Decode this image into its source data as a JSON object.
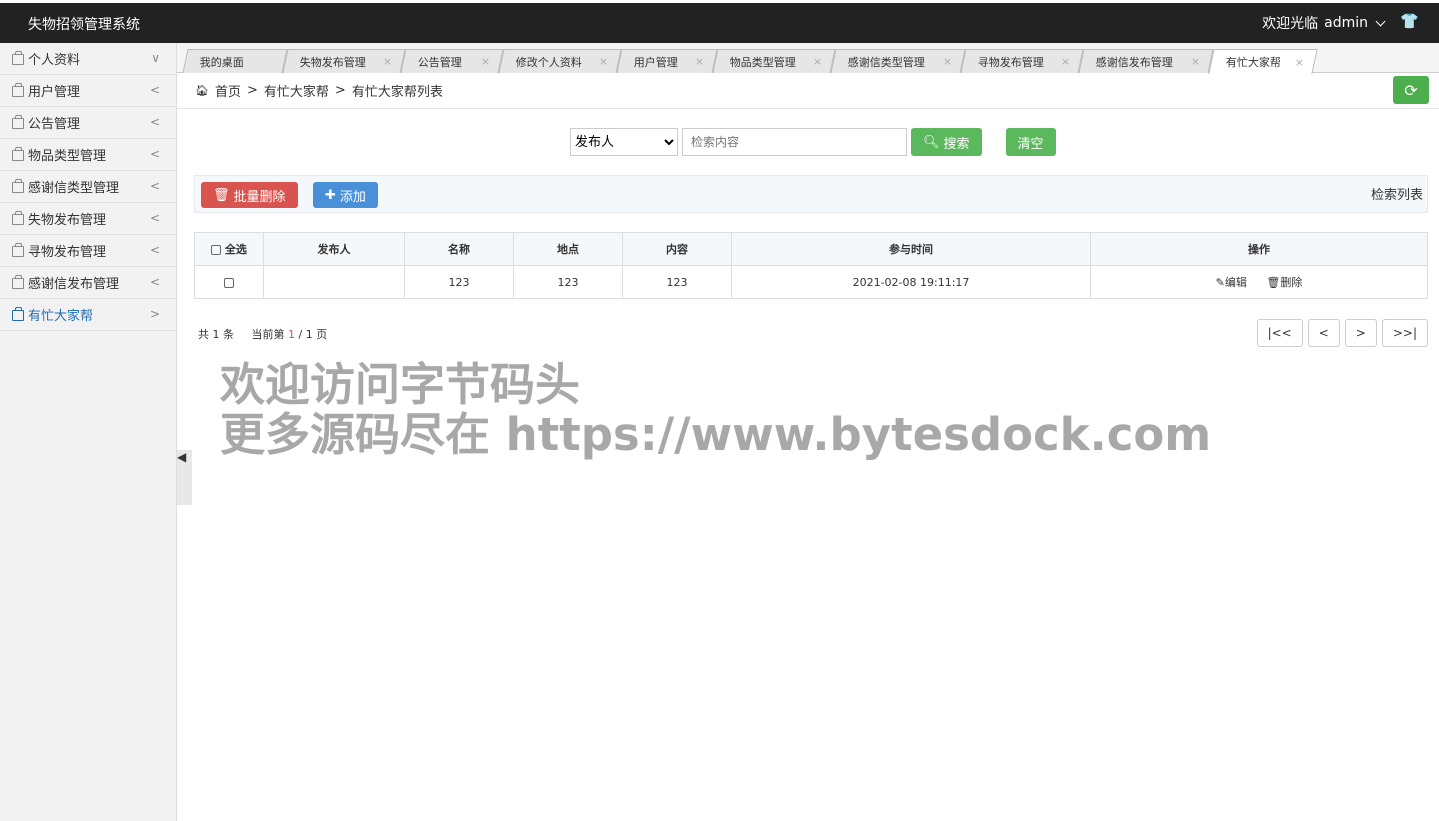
{
  "header": {
    "app_title": "失物招领管理系统",
    "welcome": "欢迎光临",
    "username": "admin",
    "shirt_icon": "shirt-icon"
  },
  "sidebar": {
    "items": [
      {
        "label": "个人资料",
        "arrow": "∨"
      },
      {
        "label": "用户管理",
        "arrow": "<"
      },
      {
        "label": "公告管理",
        "arrow": "<"
      },
      {
        "label": "物品类型管理",
        "arrow": "<"
      },
      {
        "label": "感谢信类型管理",
        "arrow": "<"
      },
      {
        "label": "失物发布管理",
        "arrow": "<"
      },
      {
        "label": "寻物发布管理",
        "arrow": "<"
      },
      {
        "label": "感谢信发布管理",
        "arrow": "<"
      },
      {
        "label": "有忙大家帮",
        "arrow": ">"
      }
    ],
    "active_index": 8
  },
  "tabs": [
    {
      "label": "我的桌面"
    },
    {
      "label": "失物发布管理"
    },
    {
      "label": "公告管理"
    },
    {
      "label": "修改个人资料"
    },
    {
      "label": "用户管理"
    },
    {
      "label": "物品类型管理"
    },
    {
      "label": "感谢信类型管理"
    },
    {
      "label": "寻物发布管理"
    },
    {
      "label": "感谢信发布管理"
    },
    {
      "label": "有忙大家帮"
    }
  ],
  "breadcrumb": {
    "home": "首页",
    "sep": ">",
    "level1": "有忙大家帮",
    "level2": "有忙大家帮列表"
  },
  "search": {
    "select_value": "发布人",
    "placeholder": "检索内容",
    "search_label": "搜索",
    "clear_label": "清空"
  },
  "actions": {
    "batch_delete": "批量删除",
    "add": "添加",
    "list_label": "检索列表"
  },
  "table": {
    "headers": [
      "全选",
      "发布人",
      "名称",
      "地点",
      "内容",
      "参与时间",
      "操作"
    ],
    "rows": [
      {
        "publisher": "",
        "name": "123",
        "place": "123",
        "content": "123",
        "time": "2021-02-08 19:11:17",
        "edit": "编辑",
        "delete": "删除"
      }
    ]
  },
  "pagination": {
    "total_prefix": "共",
    "total": "1",
    "total_suffix": "条",
    "current_prefix": "当前第",
    "current": "1",
    "slash": "/",
    "pages": "1",
    "pages_suffix": "页",
    "first": "|<<",
    "prev": "<",
    "next": ">",
    "last": ">>|"
  },
  "watermark": {
    "line1": "欢迎访问字节码头",
    "line2": "更多源码尽在  https://www.bytesdock.com"
  },
  "colors": {
    "topbar": "#222222",
    "active_link": "#1e6bb8",
    "green": "#5cb85c",
    "red": "#d9534f",
    "blue": "#4a90d9"
  }
}
